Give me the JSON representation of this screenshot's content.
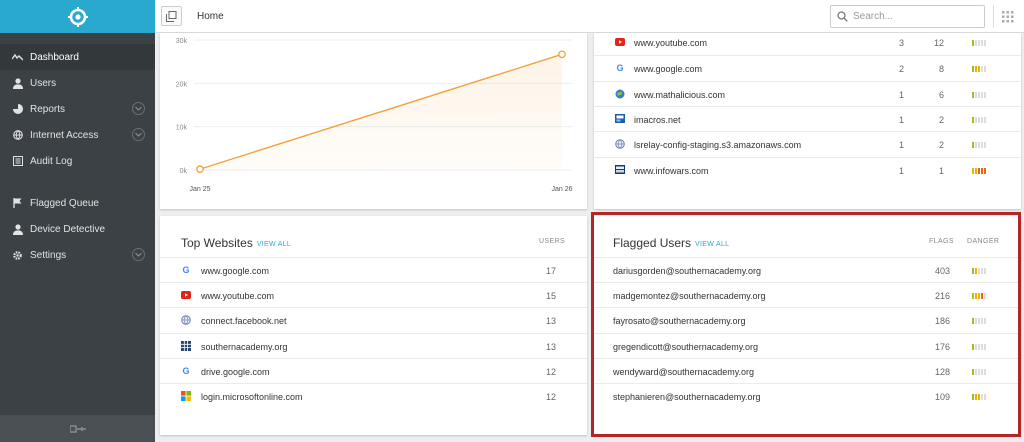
{
  "sidebar": {
    "items": [
      {
        "label": "Dashboard",
        "icon": "activity-icon",
        "active": true
      },
      {
        "label": "Users",
        "icon": "user-icon"
      },
      {
        "label": "Reports",
        "icon": "pie-chart-icon",
        "expandable": true
      },
      {
        "label": "Internet Access",
        "icon": "globe-icon",
        "expandable": true
      },
      {
        "label": "Audit Log",
        "icon": "list-icon"
      },
      {
        "label": "Flagged Queue",
        "icon": "flag-icon"
      },
      {
        "label": "Device Detective",
        "icon": "user-icon"
      },
      {
        "label": "Settings",
        "icon": "gear-icon",
        "expandable": true
      }
    ]
  },
  "topbar": {
    "breadcrumb": "Home",
    "search_placeholder": "Search..."
  },
  "chart_data": {
    "type": "area",
    "x": [
      "Jan 25",
      "Jan 26"
    ],
    "values": [
      200,
      26700
    ],
    "yticks": [
      "0k",
      "10k",
      "20k",
      "30k"
    ],
    "ylim": [
      0,
      30000
    ],
    "color": "#f5a03a"
  },
  "sites_top": {
    "rows": [
      {
        "icon": "youtube-icon",
        "name": "www.youtube.com",
        "a": "3",
        "b": "12",
        "danger": 1
      },
      {
        "icon": "google-icon",
        "name": "www.google.com",
        "a": "2",
        "b": "8",
        "danger": 3
      },
      {
        "icon": "globe-icon",
        "name": "www.mathalicious.com",
        "a": "1",
        "b": "6",
        "danger": 1
      },
      {
        "icon": "imacros-icon",
        "name": "imacros.net",
        "a": "1",
        "b": "2",
        "danger": 1
      },
      {
        "icon": "globe-outline-icon",
        "name": "lsrelay-config-staging.s3.amazonaws.com",
        "a": "1",
        "b": "2",
        "danger": 1
      },
      {
        "icon": "infowars-icon",
        "name": "www.infowars.com",
        "a": "1",
        "b": "1",
        "danger": 5
      }
    ]
  },
  "top_websites": {
    "title": "Top Websites",
    "view_all": "VIEW ALL",
    "col": "USERS",
    "rows": [
      {
        "icon": "google-icon",
        "name": "www.google.com",
        "users": "17"
      },
      {
        "icon": "youtube-icon",
        "name": "www.youtube.com",
        "users": "15"
      },
      {
        "icon": "globe-outline-icon",
        "name": "connect.facebook.net",
        "users": "13"
      },
      {
        "icon": "grid-logo-icon",
        "name": "southernacademy.org",
        "users": "13"
      },
      {
        "icon": "google-icon",
        "name": "drive.google.com",
        "users": "12"
      },
      {
        "icon": "microsoft-icon",
        "name": "login.microsoftonline.com",
        "users": "12"
      }
    ]
  },
  "flagged_users": {
    "title": "Flagged Users",
    "view_all": "VIEW ALL",
    "col_flags": "FLAGS",
    "col_danger": "DANGER",
    "rows": [
      {
        "email": "dariusgorden@southernacademy.org",
        "flags": "403",
        "danger": 2
      },
      {
        "email": "madgemontez@southernacademy.org",
        "flags": "216",
        "danger": 4
      },
      {
        "email": "fayrosato@southernacademy.org",
        "flags": "186",
        "danger": 1
      },
      {
        "email": "gregendicott@southernacademy.org",
        "flags": "176",
        "danger": 1
      },
      {
        "email": "wendyward@southernacademy.org",
        "flags": "128",
        "danger": 1
      },
      {
        "email": "stephanieren@southernacademy.org",
        "flags": "109",
        "danger": 3
      }
    ]
  },
  "colors": {
    "accent": "#2aa9cf",
    "sidebar": "#3c4145",
    "highlight": "#b52526",
    "danger_low": "#9ac31c",
    "danger_mid": "#f0b400",
    "danger_high": "#e8651f"
  }
}
